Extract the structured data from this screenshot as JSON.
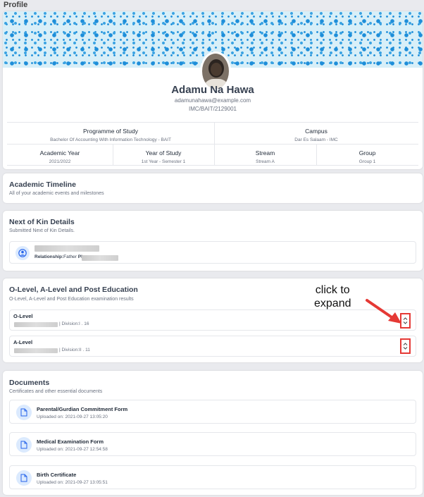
{
  "page": {
    "title": "Profile"
  },
  "profile": {
    "name": "Adamu Na Hawa",
    "email": "adamunahawa@example.com",
    "reg_no": "IMC/BAIT/2129001",
    "programme_label": "Programme of Study",
    "programme_value": "Bachelor Of Accounting With Information Technology - BAIT",
    "campus_label": "Campus",
    "campus_value": "Dar Es Salaam - IMC",
    "academic_year_label": "Academic Year",
    "academic_year_value": "2021/2022",
    "year_of_study_label": "Year of Study",
    "year_of_study_value": "1st Year - Semester 1",
    "stream_label": "Stream",
    "stream_value": "Stream A",
    "group_label": "Group",
    "group_value": "Group 1"
  },
  "timeline": {
    "title": "Academic Timeline",
    "subtitle": "All of your academic events and milestones"
  },
  "next_of_kin": {
    "title": "Next of Kin Details",
    "subtitle": "Submitted Next of Kin Details.",
    "relationship_label": "Relationship:",
    "relationship_value": "Father",
    "phone_label": "Phone"
  },
  "education": {
    "title": "O-Level, A-Level and Post Education",
    "subtitle": "O-Level, A-Level and Post Education examination results",
    "items": [
      {
        "name": "O-Level",
        "division": "| Division:I . 16"
      },
      {
        "name": "A-Level",
        "division": "| Division:II . 11"
      }
    ]
  },
  "documents": {
    "title": "Documents",
    "subtitle": "Certificates and other essential documents",
    "items": [
      {
        "title": "Parental/Gurdian Commitment Form",
        "uploaded": "Uploaded on: 2021-09-27 13:05:20"
      },
      {
        "title": "Medical Examination Form",
        "uploaded": "Uploaded on: 2021-09-27 12:54:58"
      },
      {
        "title": "Birth Certificate",
        "uploaded": "Uploaded on: 2021-09-27 13:05:51"
      }
    ]
  },
  "annotation": {
    "line1": "click to",
    "line2": "expand"
  },
  "colors": {
    "accent": "#1e8ed9",
    "annotation_red": "#e53935",
    "icon_bg": "#dbeafe"
  },
  "icons": [
    "person-icon",
    "document-icon",
    "chevron-updown-icon"
  ]
}
